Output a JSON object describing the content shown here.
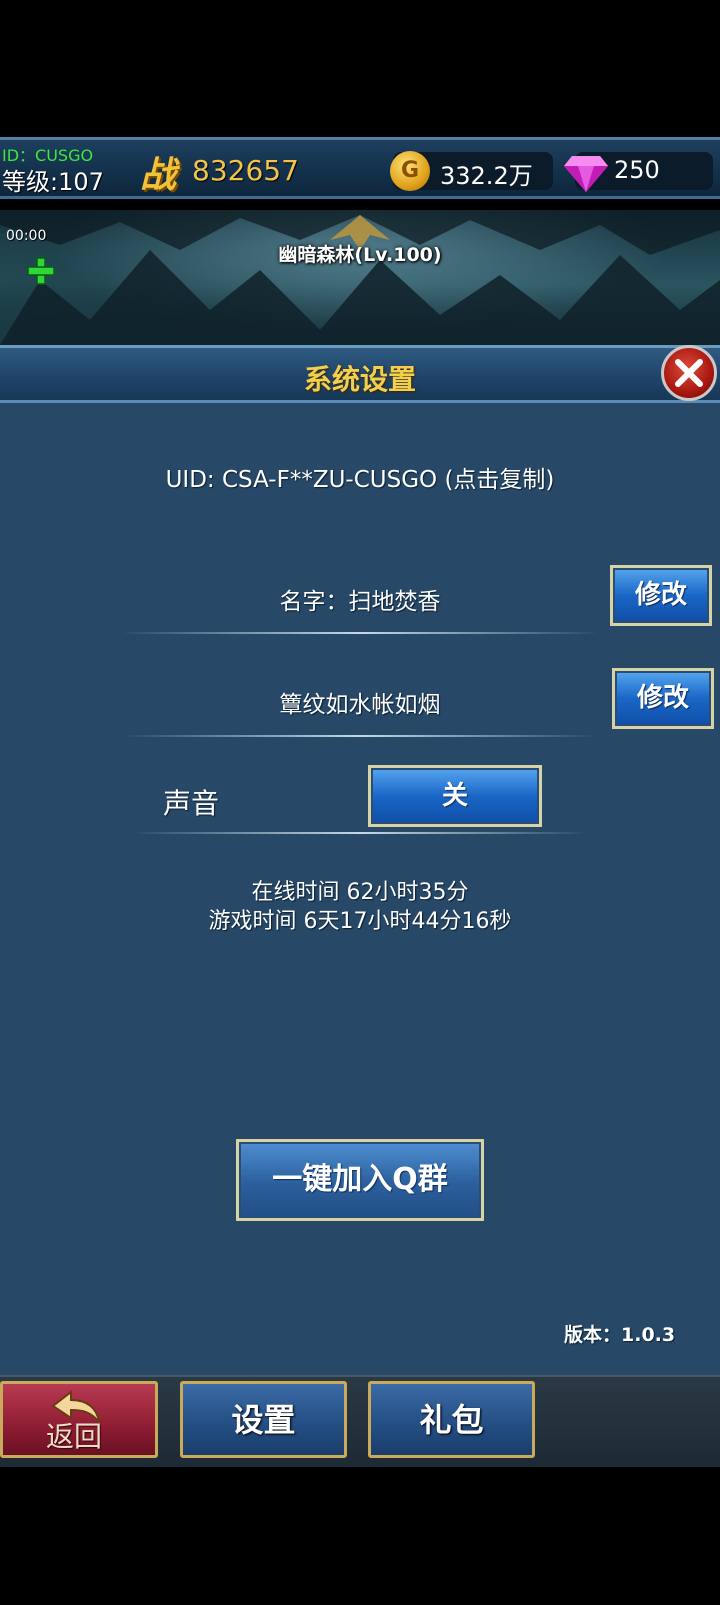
{
  "player": {
    "id_line": "ID：CUSGO",
    "level": "等级:107",
    "power_icon": "战",
    "power": "832657",
    "gold_icon": "G",
    "gold": "332.2万",
    "gems": "250"
  },
  "scene": {
    "timer": "00:00",
    "map_name": "幽暗森林(Lv.100)"
  },
  "settings": {
    "title": "系统设置",
    "uid": "UID: CSA-F**ZU-CUSGO (点击复制)",
    "name": "名字：扫地焚香",
    "rename_label": "修改",
    "motto": "簟纹如水帐如烟",
    "remotto_label": "修改",
    "sound_label": "声音",
    "sound_value": "关",
    "online_time": "在线时间 62小时35分",
    "play_time": "游戏时间 6天17小时44分16秒",
    "qgroup_label": "一键加入Q群",
    "version": "版本：1.0.3"
  },
  "nav": {
    "back": "返回",
    "settings": "设置",
    "gift": "礼包"
  },
  "colors": {
    "panel_bg": "#274866",
    "title_gold": "#f2cf4c",
    "power_gold": "#f3c34a",
    "id_green": "#3ee63e",
    "button_blue": "#1a66c7",
    "back_red": "#8e1d33"
  },
  "icons": [
    "gold-coin-icon",
    "diamond-gem-icon",
    "power-emblem-icon",
    "add-plus-icon",
    "close-icon",
    "back-arrow-icon"
  ]
}
